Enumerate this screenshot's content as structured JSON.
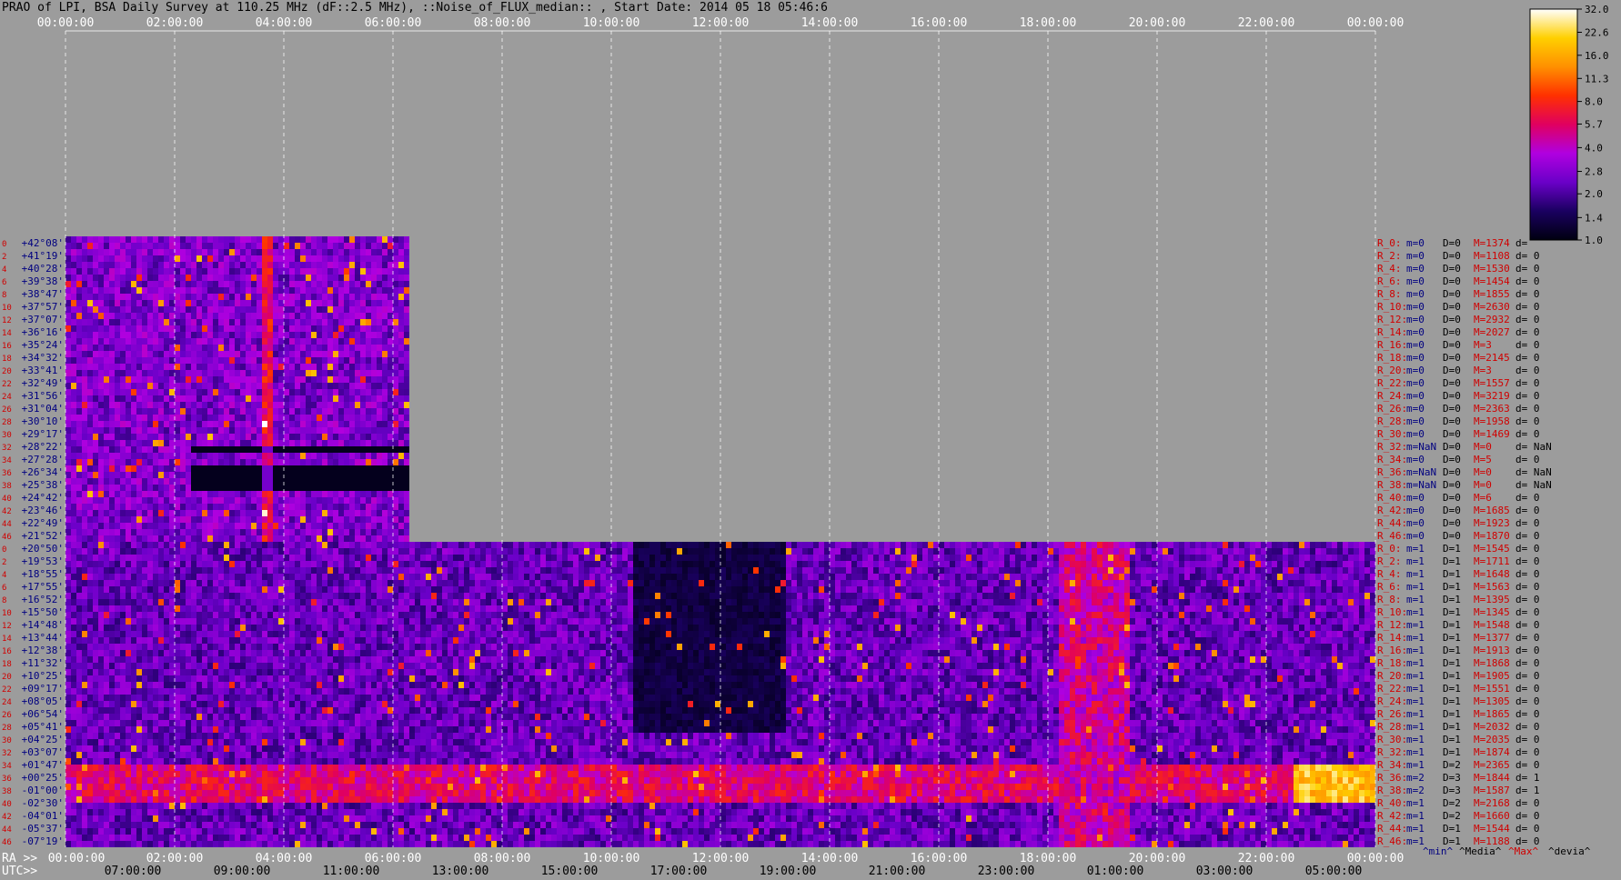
{
  "title": "PRAO of LPI, BSA Daily Survey at 110.25 MHz (dF::2.5 MHz), ::Noise_of_FLUX_median:: , Start Date: 2014 05 18 05:46:6",
  "colors": {
    "background": "#9c9c9c",
    "label_red": "#d00000",
    "label_blue": "#000080"
  },
  "chart_data": {
    "type": "heatmap",
    "title": "PRAO of LPI, BSA Daily Survey at 110.25 MHz (dF::2.5 MHz), ::Noise_of_FLUX_median:: , Start Date: 2014 05 18 05:46:6",
    "x_top_ticks": [
      "00:00:00",
      "02:00:00",
      "04:00:00",
      "06:00:00",
      "08:00:00",
      "10:00:00",
      "12:00:00",
      "14:00:00",
      "16:00:00",
      "18:00:00",
      "20:00:00",
      "22:00:00",
      "00:00:00"
    ],
    "x_bottom_ra_prefix": "RA >>",
    "x_bottom_ra_ticks": [
      "00:00:00",
      "02:00:00",
      "04:00:00",
      "06:00:00",
      "08:00:00",
      "10:00:00",
      "12:00:00",
      "14:00:00",
      "16:00:00",
      "18:00:00",
      "20:00:00",
      "22:00:00",
      "00:00:00"
    ],
    "x_bottom_utc_prefix": "UTC>>",
    "x_bottom_utc_ticks": [
      "07:00:00",
      "09:00:00",
      "11:00:00",
      "13:00:00",
      "15:00:00",
      "17:00:00",
      "19:00:00",
      "21:00:00",
      "23:00:00",
      "01:00:00",
      "03:00:00",
      "05:00:00"
    ],
    "y_labels_upper": [
      "+42°08'",
      "+41°19'",
      "+40°28'",
      "+39°38'",
      "+38°47'",
      "+37°57'",
      "+37°07'",
      "+36°16'",
      "+35°24'",
      "+34°32'",
      "+33°41'",
      "+32°49'",
      "+31°56'",
      "+31°04'",
      "+30°10'",
      "+29°17'",
      "+28°22'",
      "+27°28'",
      "+26°34'",
      "+25°38'",
      "+24°42'",
      "+23°46'",
      "+22°49'",
      "+21°52'"
    ],
    "y_labels_lower": [
      "+20°50'",
      "+19°53'",
      "+18°55'",
      "+17°55'",
      "+16°52'",
      "+15°50'",
      "+14°48'",
      "+13°44'",
      "+12°38'",
      "+11°32'",
      "+10°25'",
      "+09°17'",
      "+08°05'",
      "+06°54'",
      "+05°41'",
      "+04°25'",
      "+03°07'",
      "+01°47'",
      "+00°25'",
      "-01°00'",
      "-02°30'",
      "-04°01'",
      "-05°37'",
      "-07°19'"
    ],
    "beam_index_upper": [
      "0",
      "2",
      "4",
      "6",
      "8",
      "10",
      "12",
      "14",
      "16",
      "18",
      "20",
      "22",
      "24",
      "26",
      "28",
      "30",
      "32",
      "34",
      "36",
      "38",
      "40",
      "42",
      "44",
      "46"
    ],
    "beam_index_lower": [
      "0",
      "2",
      "4",
      "6",
      "8",
      "10",
      "12",
      "14",
      "16",
      "18",
      "20",
      "22",
      "24",
      "26",
      "28",
      "30",
      "32",
      "34",
      "36",
      "38",
      "40",
      "42",
      "44",
      "46"
    ],
    "colorbar_ticks": [
      "32.0",
      "22.6",
      "16.0",
      "11.3",
      "8.0",
      "5.7",
      "4.0",
      "2.8",
      "2.0",
      "1.4",
      "1.0"
    ],
    "colorbar_range": [
      1.0,
      32.0
    ],
    "colorbar_scale": "log",
    "colorbar_stops": [
      "#000010",
      "#1a0060",
      "#6a00c8",
      "#b000e0",
      "#e00060",
      "#ff3000",
      "#ff9000",
      "#ffd000",
      "#ffffff"
    ],
    "row_stats_header": [
      "^min^",
      "^Media^",
      "^Max^",
      "^devia^"
    ],
    "row_stats_upper": [
      {
        "r": "R_0:",
        "m": "m=0",
        "d": "D=0",
        "M": "M=1374",
        "dv": "d="
      },
      {
        "r": "R_2:",
        "m": "m=0",
        "d": "D=0",
        "M": "M=1108",
        "dv": "d= 0"
      },
      {
        "r": "R_4:",
        "m": "m=0",
        "d": "D=0",
        "M": "M=1530",
        "dv": "d= 0"
      },
      {
        "r": "R_6:",
        "m": "m=0",
        "d": "D=0",
        "M": "M=1454",
        "dv": "d= 0"
      },
      {
        "r": "R_8:",
        "m": "m=0",
        "d": "D=0",
        "M": "M=1855",
        "dv": "d= 0"
      },
      {
        "r": "R_10:",
        "m": "m=0",
        "d": "D=0",
        "M": "M=2630",
        "dv": "d= 0"
      },
      {
        "r": "R_12:",
        "m": "m=0",
        "d": "D=0",
        "M": "M=2932",
        "dv": "d= 0"
      },
      {
        "r": "R_14:",
        "m": "m=0",
        "d": "D=0",
        "M": "M=2027",
        "dv": "d= 0"
      },
      {
        "r": "R_16:",
        "m": "m=0",
        "d": "D=0",
        "M": "M=3",
        "dv": "d= 0"
      },
      {
        "r": "R_18:",
        "m": "m=0",
        "d": "D=0",
        "M": "M=2145",
        "dv": "d= 0"
      },
      {
        "r": "R_20:",
        "m": "m=0",
        "d": "D=0",
        "M": "M=3",
        "dv": "d= 0"
      },
      {
        "r": "R_22:",
        "m": "m=0",
        "d": "D=0",
        "M": "M=1557",
        "dv": "d= 0"
      },
      {
        "r": "R_24:",
        "m": "m=0",
        "d": "D=0",
        "M": "M=3219",
        "dv": "d= 0"
      },
      {
        "r": "R_26:",
        "m": "m=0",
        "d": "D=0",
        "M": "M=2363",
        "dv": "d= 0"
      },
      {
        "r": "R_28:",
        "m": "m=0",
        "d": "D=0",
        "M": "M=1958",
        "dv": "d= 0"
      },
      {
        "r": "R_30:",
        "m": "m=0",
        "d": "D=0",
        "M": "M=1469",
        "dv": "d= 0"
      },
      {
        "r": "R_32:",
        "m": "m=NaN",
        "d": "D=0",
        "M": "M=0",
        "dv": "d= NaN"
      },
      {
        "r": "R_34:",
        "m": "m=0",
        "d": "D=0",
        "M": "M=5",
        "dv": "d= 0"
      },
      {
        "r": "R_36:",
        "m": "m=NaN",
        "d": "D=0",
        "M": "M=0",
        "dv": "d= NaN"
      },
      {
        "r": "R_38:",
        "m": "m=NaN",
        "d": "D=0",
        "M": "M=0",
        "dv": "d= NaN"
      },
      {
        "r": "R_40:",
        "m": "m=0",
        "d": "D=0",
        "M": "M=6",
        "dv": "d= 0"
      },
      {
        "r": "R_42:",
        "m": "m=0",
        "d": "D=0",
        "M": "M=1685",
        "dv": "d= 0"
      },
      {
        "r": "R_44:",
        "m": "m=0",
        "d": "D=0",
        "M": "M=1923",
        "dv": "d= 0"
      },
      {
        "r": "R_46:",
        "m": "m=0",
        "d": "D=0",
        "M": "M=1870",
        "dv": "d= 0"
      }
    ],
    "row_stats_lower": [
      {
        "r": "R_0:",
        "m": "m=1",
        "d": "D=1",
        "M": "M=1545",
        "dv": "d= 0"
      },
      {
        "r": "R_2:",
        "m": "m=1",
        "d": "D=1",
        "M": "M=1711",
        "dv": "d= 0"
      },
      {
        "r": "R_4:",
        "m": "m=1",
        "d": "D=1",
        "M": "M=1648",
        "dv": "d= 0"
      },
      {
        "r": "R_6:",
        "m": "m=1",
        "d": "D=1",
        "M": "M=1563",
        "dv": "d= 0"
      },
      {
        "r": "R_8:",
        "m": "m=1",
        "d": "D=1",
        "M": "M=1395",
        "dv": "d= 0"
      },
      {
        "r": "R_10:",
        "m": "m=1",
        "d": "D=1",
        "M": "M=1345",
        "dv": "d= 0"
      },
      {
        "r": "R_12:",
        "m": "m=1",
        "d": "D=1",
        "M": "M=1548",
        "dv": "d= 0"
      },
      {
        "r": "R_14:",
        "m": "m=1",
        "d": "D=1",
        "M": "M=1377",
        "dv": "d= 0"
      },
      {
        "r": "R_16:",
        "m": "m=1",
        "d": "D=1",
        "M": "M=1913",
        "dv": "d= 0"
      },
      {
        "r": "R_18:",
        "m": "m=1",
        "d": "D=1",
        "M": "M=1868",
        "dv": "d= 0"
      },
      {
        "r": "R_20:",
        "m": "m=1",
        "d": "D=1",
        "M": "M=1905",
        "dv": "d= 0"
      },
      {
        "r": "R_22:",
        "m": "m=1",
        "d": "D=1",
        "M": "M=1551",
        "dv": "d= 0"
      },
      {
        "r": "R_24:",
        "m": "m=1",
        "d": "D=1",
        "M": "M=1305",
        "dv": "d= 0"
      },
      {
        "r": "R_26:",
        "m": "m=1",
        "d": "D=1",
        "M": "M=1865",
        "dv": "d= 0"
      },
      {
        "r": "R_28:",
        "m": "m=1",
        "d": "D=1",
        "M": "M=2032",
        "dv": "d= 0"
      },
      {
        "r": "R_30:",
        "m": "m=1",
        "d": "D=1",
        "M": "M=2035",
        "dv": "d= 0"
      },
      {
        "r": "R_32:",
        "m": "m=1",
        "d": "D=1",
        "M": "M=1874",
        "dv": "d= 0"
      },
      {
        "r": "R_34:",
        "m": "m=1",
        "d": "D=2",
        "M": "M=2365",
        "dv": "d= 0"
      },
      {
        "r": "R_36:",
        "m": "m=2",
        "d": "D=3",
        "M": "M=1844",
        "dv": "d= 1"
      },
      {
        "r": "R_38:",
        "m": "m=2",
        "d": "D=3",
        "M": "M=1587",
        "dv": "d= 1"
      },
      {
        "r": "R_40:",
        "m": "m=1",
        "d": "D=2",
        "M": "M=2168",
        "dv": "d= 0"
      },
      {
        "r": "R_42:",
        "m": "m=1",
        "d": "D=2",
        "M": "M=1660",
        "dv": "d= 0"
      },
      {
        "r": "R_44:",
        "m": "m=1",
        "d": "D=1",
        "M": "M=1544",
        "dv": "d= 0"
      },
      {
        "r": "R_46:",
        "m": "m=1",
        "d": "D=1",
        "M": "M=1188",
        "dv": "d= 0"
      }
    ],
    "grid": true
  }
}
